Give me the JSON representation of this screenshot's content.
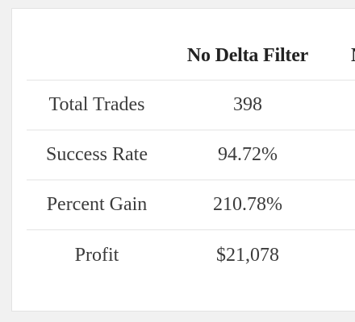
{
  "table": {
    "columns": [
      "",
      "No Delta Filter",
      "N"
    ],
    "rows": [
      {
        "label": "Total Trades",
        "value": "398"
      },
      {
        "label": "Success Rate",
        "value": "94.72%"
      },
      {
        "label": "Percent Gain",
        "value": "210.78%"
      },
      {
        "label": "Profit",
        "value": "$21,078"
      }
    ]
  },
  "colors": {
    "page_background": "#f1f1f1",
    "card_background": "#ffffff",
    "row_divider": "#e4e4e4",
    "text": "#3b3b3b"
  }
}
